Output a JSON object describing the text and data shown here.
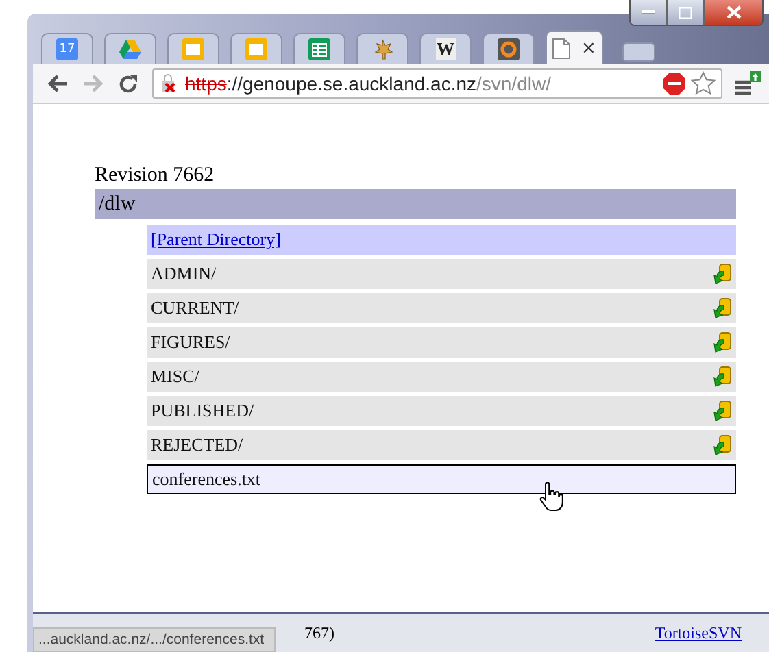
{
  "browser": {
    "tabs": [
      {
        "kind": "calendar",
        "text": "17",
        "selected": false
      },
      {
        "kind": "drive",
        "selected": false
      },
      {
        "kind": "slides",
        "selected": false
      },
      {
        "kind": "slides",
        "selected": false
      },
      {
        "kind": "sheets",
        "selected": false
      },
      {
        "kind": "leaf",
        "selected": false
      },
      {
        "kind": "letter",
        "text": "W",
        "selected": false
      },
      {
        "kind": "ring",
        "selected": false
      },
      {
        "kind": "page",
        "selected": true,
        "close": "×"
      }
    ],
    "address": {
      "scheme": "https",
      "host": "://genoupe.se.auckland.ac.nz",
      "path": "/svn/dlw/",
      "secure": false
    }
  },
  "page": {
    "title": "Revision 7662",
    "path": "/dlw",
    "entries": [
      {
        "kind": "parent",
        "name": "[Parent Directory]",
        "hovered": false
      },
      {
        "kind": "dir",
        "name": "ADMIN/",
        "hovered": false
      },
      {
        "kind": "dir",
        "name": "CURRENT/",
        "hovered": false
      },
      {
        "kind": "dir",
        "name": "FIGURES/",
        "hovered": false
      },
      {
        "kind": "dir",
        "name": "MISC/",
        "hovered": false
      },
      {
        "kind": "dir",
        "name": "PUBLISHED/",
        "hovered": false
      },
      {
        "kind": "dir",
        "name": "REJECTED/",
        "hovered": false
      },
      {
        "kind": "file",
        "name": "conferences.txt",
        "hovered": true
      }
    ],
    "footer_text": "767)",
    "footer_link": "TortoiseSVN"
  },
  "status_bubble": "...auckland.ac.nz/.../conferences.txt"
}
